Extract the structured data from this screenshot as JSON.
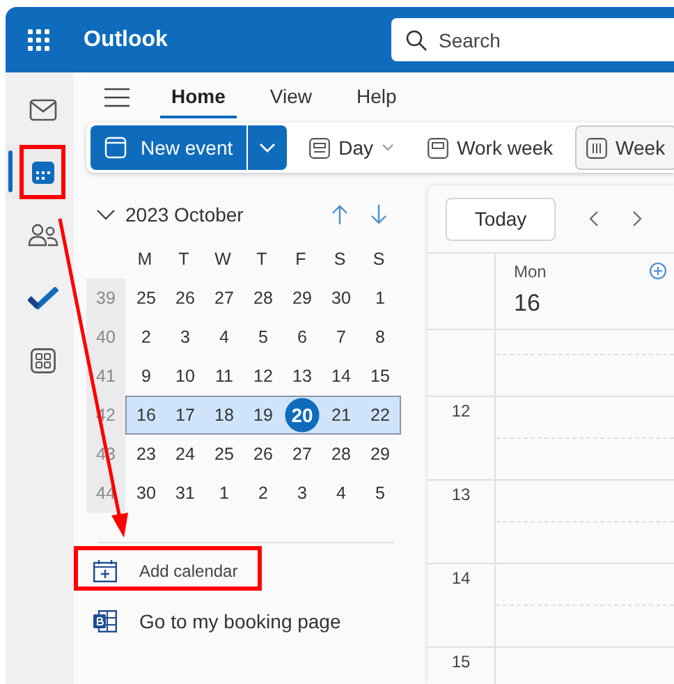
{
  "top_bar": {
    "app_name": "Outlook",
    "search": {
      "placeholder": "Search"
    }
  },
  "rail": [
    {
      "kind": "mail",
      "selected": false,
      "highlighted": false
    },
    {
      "kind": "calendar",
      "selected": true,
      "highlighted": true
    },
    {
      "kind": "people",
      "selected": false,
      "highlighted": false
    },
    {
      "kind": "todo",
      "selected": false,
      "highlighted": false
    },
    {
      "kind": "apps",
      "selected": false,
      "highlighted": false
    }
  ],
  "ribbon": {
    "tabs": [
      {
        "label": "Home",
        "selected": true
      },
      {
        "label": "View",
        "selected": false
      },
      {
        "label": "Help",
        "selected": false
      }
    ]
  },
  "toolbar": {
    "new_event": "New event",
    "views": [
      {
        "kind": "day",
        "label": "Day",
        "selected": false,
        "has_menu": true
      },
      {
        "kind": "work_week",
        "label": "Work week",
        "selected": false,
        "has_menu": false
      },
      {
        "kind": "week",
        "label": "Week",
        "selected": true,
        "has_menu": false
      }
    ]
  },
  "mini_calendar": {
    "title": "2023 October",
    "weekdays": [
      "M",
      "T",
      "W",
      "T",
      "F",
      "S",
      "S"
    ],
    "weeks": [
      {
        "number": "39",
        "selected": false,
        "days": [
          {
            "label": "25",
            "today": false
          },
          {
            "label": "26",
            "today": false
          },
          {
            "label": "27",
            "today": false
          },
          {
            "label": "28",
            "today": false
          },
          {
            "label": "29",
            "today": false
          },
          {
            "label": "30",
            "today": false
          },
          {
            "label": "1",
            "today": false
          }
        ]
      },
      {
        "number": "40",
        "selected": false,
        "days": [
          {
            "label": "2",
            "today": false
          },
          {
            "label": "3",
            "today": false
          },
          {
            "label": "4",
            "today": false
          },
          {
            "label": "5",
            "today": false
          },
          {
            "label": "6",
            "today": false
          },
          {
            "label": "7",
            "today": false
          },
          {
            "label": "8",
            "today": false
          }
        ]
      },
      {
        "number": "41",
        "selected": false,
        "days": [
          {
            "label": "9",
            "today": false
          },
          {
            "label": "10",
            "today": false
          },
          {
            "label": "11",
            "today": false
          },
          {
            "label": "12",
            "today": false
          },
          {
            "label": "13",
            "today": false
          },
          {
            "label": "14",
            "today": false
          },
          {
            "label": "15",
            "today": false
          }
        ]
      },
      {
        "number": "42",
        "selected": true,
        "days": [
          {
            "label": "16",
            "today": false
          },
          {
            "label": "17",
            "today": false
          },
          {
            "label": "18",
            "today": false
          },
          {
            "label": "19",
            "today": false
          },
          {
            "label": "20",
            "today": true
          },
          {
            "label": "21",
            "today": false
          },
          {
            "label": "22",
            "today": false
          }
        ]
      },
      {
        "number": "43",
        "selected": false,
        "days": [
          {
            "label": "23",
            "today": false
          },
          {
            "label": "24",
            "today": false
          },
          {
            "label": "25",
            "today": false
          },
          {
            "label": "26",
            "today": false
          },
          {
            "label": "27",
            "today": false
          },
          {
            "label": "28",
            "today": false
          },
          {
            "label": "29",
            "today": false
          }
        ]
      },
      {
        "number": "44",
        "selected": false,
        "days": [
          {
            "label": "30",
            "today": false
          },
          {
            "label": "31",
            "today": false
          },
          {
            "label": "1",
            "today": false
          },
          {
            "label": "2",
            "today": false
          },
          {
            "label": "3",
            "today": false
          },
          {
            "label": "4",
            "today": false
          },
          {
            "label": "5",
            "today": false
          }
        ]
      }
    ]
  },
  "links": [
    {
      "kind": "add_calendar",
      "label": "Add calendar",
      "highlighted": true
    },
    {
      "kind": "booking",
      "label": "Go to my booking page",
      "highlighted": false
    }
  ],
  "day_view": {
    "today_button": "Today",
    "days": [
      {
        "weekday": "Mon",
        "date": "16"
      }
    ],
    "hours": [
      "12",
      "13",
      "14",
      "15"
    ]
  }
}
